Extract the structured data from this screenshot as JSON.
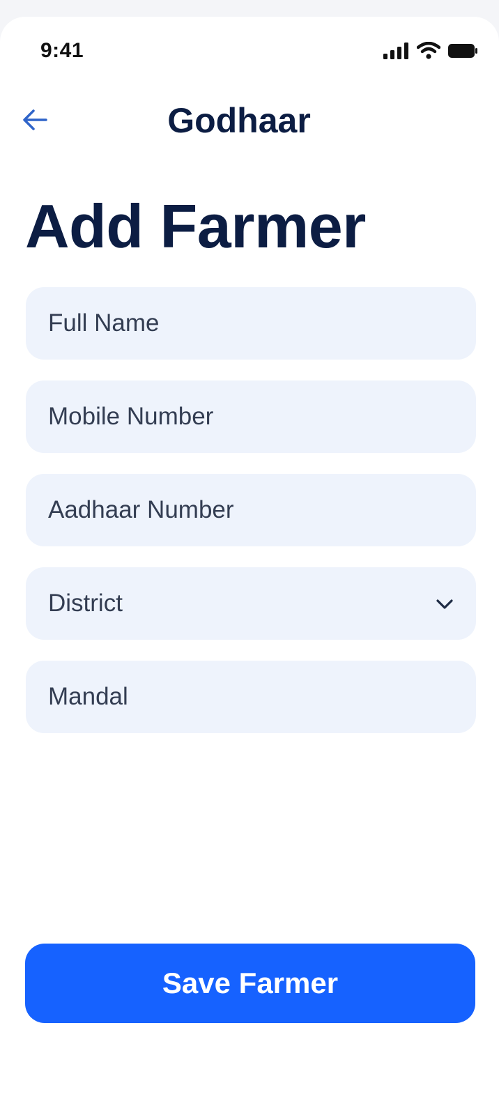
{
  "status_bar": {
    "time": "9:41",
    "icons": [
      "cellular-signal-icon",
      "wifi-icon",
      "battery-icon"
    ]
  },
  "header": {
    "back_icon": "arrow-left-icon",
    "app_title": "Godhaar"
  },
  "page": {
    "title": "Add Farmer"
  },
  "form": {
    "full_name": {
      "placeholder": "Full Name",
      "value": ""
    },
    "mobile_number": {
      "placeholder": "Mobile Number",
      "value": ""
    },
    "aadhaar_number": {
      "placeholder": "Aadhaar Number",
      "value": ""
    },
    "district": {
      "selected": "District",
      "icon": "chevron-down-icon"
    },
    "mandal": {
      "placeholder": "Mandal",
      "value": ""
    }
  },
  "actions": {
    "save_label": "Save Farmer"
  },
  "colors": {
    "primary": "#1662ff",
    "title": "#0c1d43",
    "field_bg": "#eef3fc",
    "back_arrow": "#2f64c9"
  }
}
